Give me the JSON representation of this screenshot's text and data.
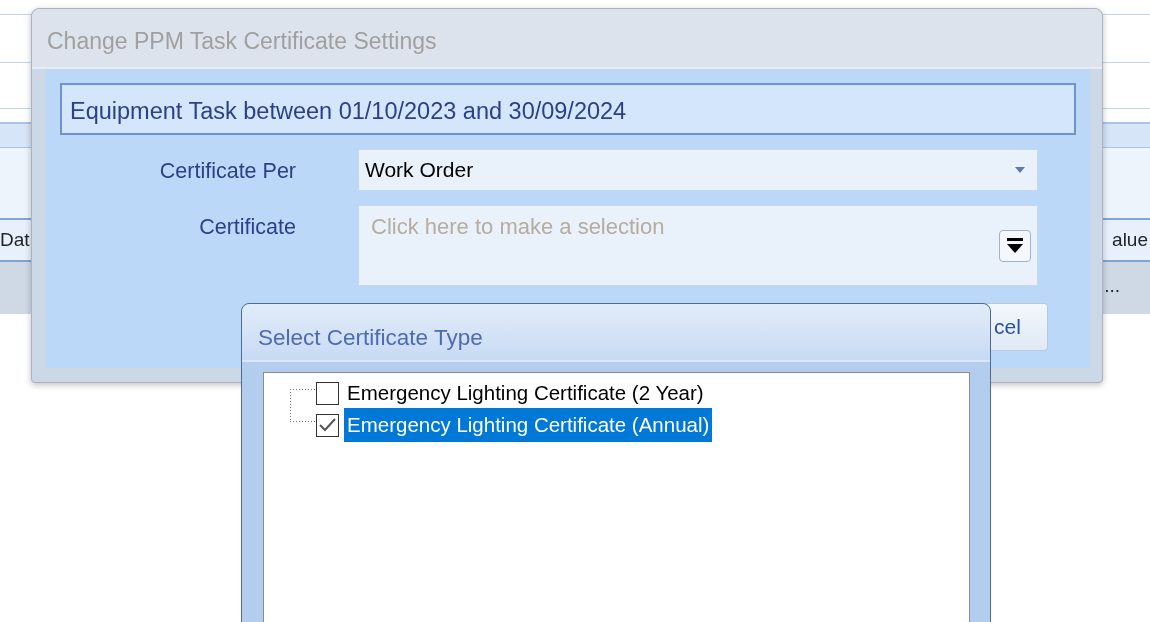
{
  "background": {
    "column_headers": [
      "Dat",
      "alue"
    ],
    "row_cell": "..."
  },
  "dialog": {
    "title": "Change PPM Task Certificate Settings",
    "info": "Equipment Task between 01/10/2023 and 30/09/2024",
    "fields": [
      {
        "kind": "combo",
        "label": "Certificate Per",
        "value": "Work Order"
      },
      {
        "kind": "picker",
        "label": "Certificate",
        "placeholder": "Click here to make a selection"
      }
    ],
    "buttons": [
      "cel"
    ]
  },
  "popup": {
    "title": "Select Certificate Type",
    "items": [
      {
        "label": "Emergency Lighting Certificate (2 Year)",
        "checked": false,
        "selected": false
      },
      {
        "label": "Emergency Lighting Certificate (Annual)",
        "checked": true,
        "selected": true
      }
    ]
  }
}
